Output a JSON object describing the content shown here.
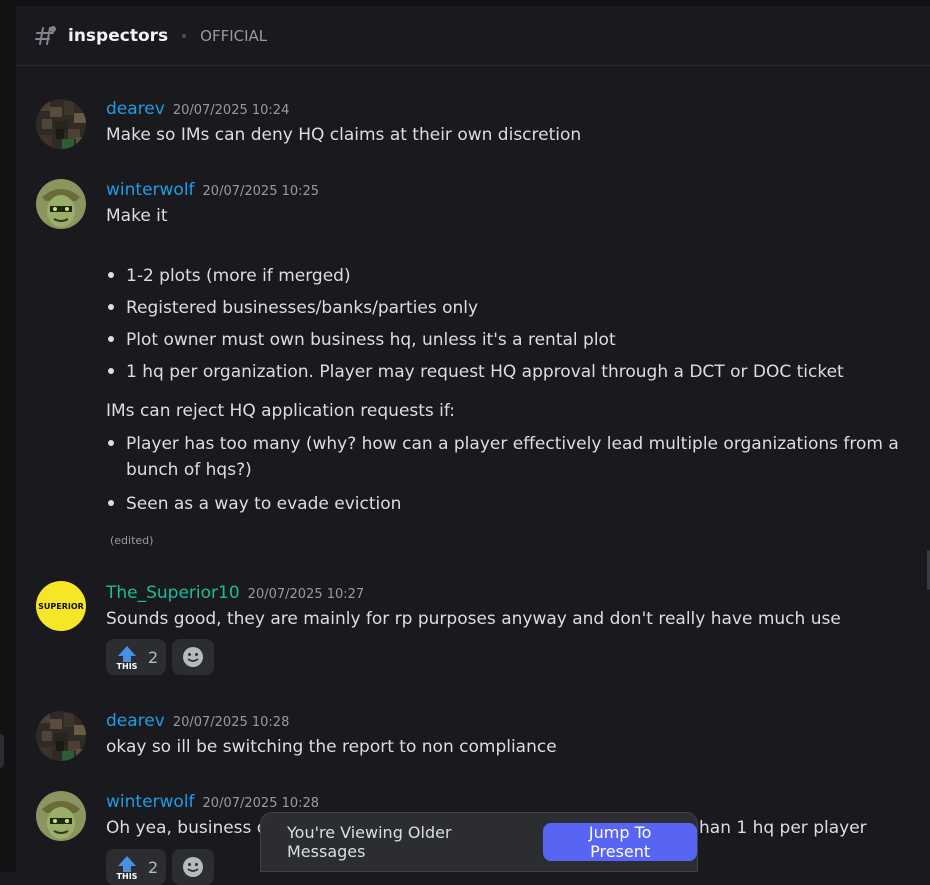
{
  "channel": {
    "name": "inspectors",
    "topic": "OFFICIAL"
  },
  "colors": {
    "dearev": "#1e9de4",
    "winterwolf": "#1e9de4",
    "superior": "#1abc9c",
    "accent": "#5865f2"
  },
  "messages": [
    {
      "author": "dearev",
      "timestamp": "20/07/2025 10:24",
      "lines": [
        "Make so IMs can deny HQ claims at their own discretion"
      ]
    },
    {
      "author": "winterwolf",
      "timestamp": "20/07/2025 10:25",
      "intro": "Make it",
      "bullets": [
        "1-2 plots (more if merged)",
        "Registered businesses/banks/parties only",
        "Plot owner must own business hq, unless it's a rental plot",
        "1 hq per organization. Player may request HQ approval through a DCT or DOC ticket"
      ],
      "reject_heading": "IMs can reject HQ application requests if:",
      "reject_bullets": [
        "Player has too many (why? how can a player effectively lead multiple organizations from a",
        "bunch of hqs?)",
        "Seen as a way to evade eviction"
      ],
      "edited": "(edited)"
    },
    {
      "author": "The_Superior10",
      "timestamp": "20/07/2025 10:27",
      "avatar_text": "SUPERIOR",
      "lines": [
        "Sounds good, they are mainly for rp purposes anyway and don't really have much use"
      ],
      "reaction": {
        "emoji_label": "THIS",
        "count": "2",
        "icon": "upvote-this-icon"
      }
    },
    {
      "author": "dearev",
      "timestamp": "20/07/2025 10:28",
      "lines": [
        "okay so ill be switching the report to non compliance"
      ]
    },
    {
      "author": "winterwolf",
      "timestamp": "20/07/2025 10:28",
      "lines": [
        "Oh yea, business o",
        "han 1 hq per player"
      ],
      "reaction": {
        "emoji_label": "THIS",
        "count": "2",
        "icon": "upvote-this-icon"
      }
    }
  ],
  "older_bar": {
    "text": "You're Viewing Older Messages",
    "button": "Jump To Present"
  }
}
